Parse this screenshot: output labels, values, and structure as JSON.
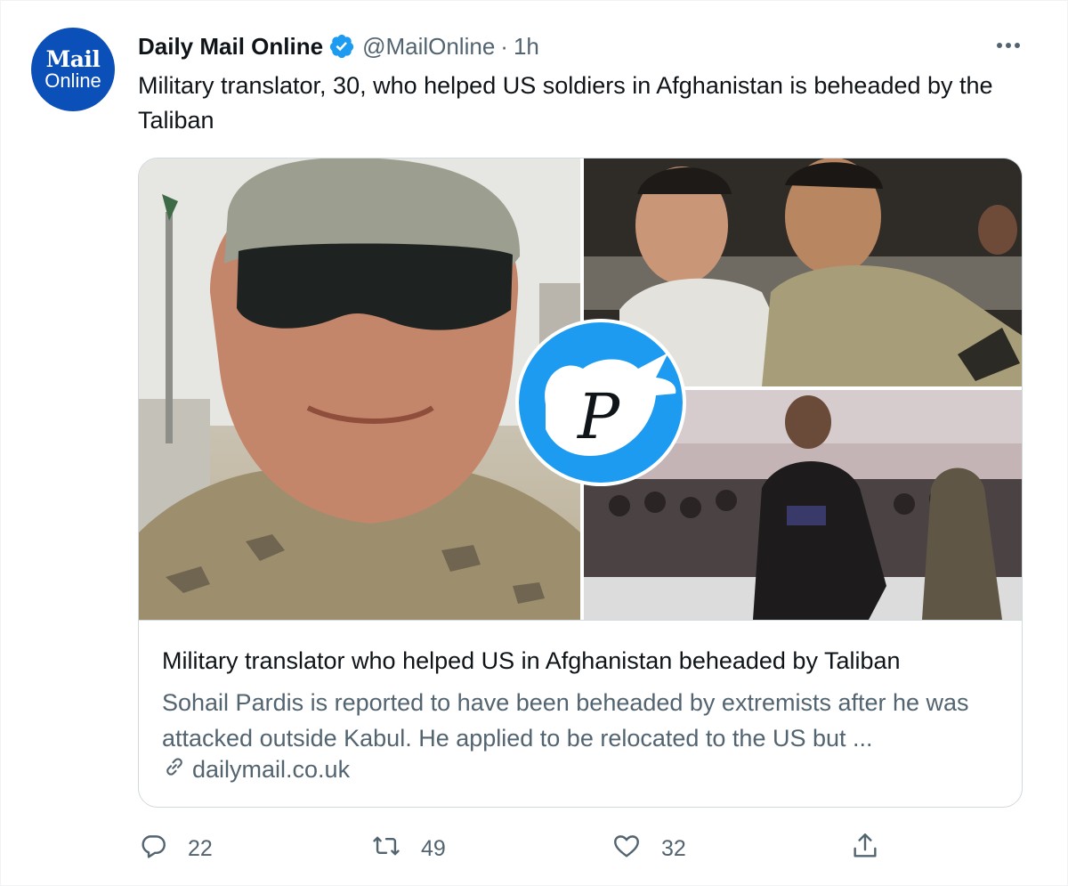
{
  "author": {
    "name": "Daily Mail Online",
    "handle": "@MailOnline",
    "separator": "·",
    "time": "1h",
    "avatar_line1": "Mail",
    "avatar_line2": "Online",
    "verified": true
  },
  "tweet": {
    "text": "Military translator, 30, who helped US soldiers in Afghanistan is beheaded by the Taliban"
  },
  "card": {
    "title": "Military translator who helped US in Afghanistan beheaded by Taliban",
    "description": "Sohail Pardis is reported to have been beheaded by extremists after he was attacked outside Kabul. He applied to be relocated to the US but ...",
    "domain": "dailymail.co.uk"
  },
  "actions": {
    "replies": "22",
    "retweets": "49",
    "likes": "32"
  },
  "watermark": {
    "letter": "P"
  },
  "colors": {
    "brand_blue": "#0b4fb8",
    "verified_blue": "#1d9bf0",
    "text_primary": "#0f1419",
    "text_secondary": "#536471",
    "border": "#cfd9de"
  },
  "icons": {
    "reply": "reply-icon",
    "retweet": "retweet-icon",
    "like": "heart-icon",
    "share": "share-icon",
    "more": "more-icon",
    "link": "link-icon",
    "verified": "verified-badge-icon"
  }
}
